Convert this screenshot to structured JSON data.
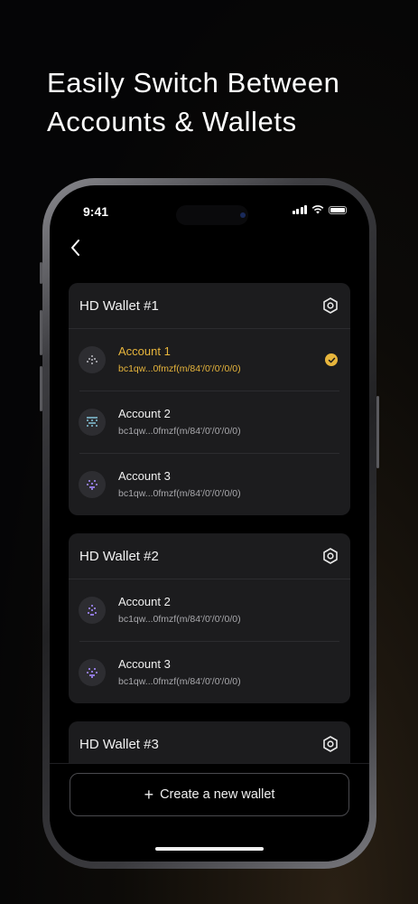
{
  "headline": "Easily Switch Between\nAccounts & Wallets",
  "status_bar": {
    "time": "9:41"
  },
  "colors": {
    "accent": "#e7b53c",
    "card_bg": "#1c1c1e",
    "background": "#000000"
  },
  "wallets": [
    {
      "name": "HD Wallet #1",
      "accounts": [
        {
          "name": "Account 1",
          "address": "bc1qw...0fmzf(m/84'/0'/0'/0/0)",
          "selected": true
        },
        {
          "name": "Account 2",
          "address": "bc1qw...0fmzf(m/84'/0'/0'/0/0)",
          "selected": false
        },
        {
          "name": "Account 3",
          "address": "bc1qw...0fmzf(m/84'/0'/0'/0/0)",
          "selected": false
        }
      ]
    },
    {
      "name": "HD Wallet #2",
      "accounts": [
        {
          "name": "Account 2",
          "address": "bc1qw...0fmzf(m/84'/0'/0'/0/0)",
          "selected": false
        },
        {
          "name": "Account 3",
          "address": "bc1qw...0fmzf(m/84'/0'/0'/0/0)",
          "selected": false
        }
      ]
    },
    {
      "name": "HD Wallet #3",
      "accounts": []
    }
  ],
  "create_button": {
    "icon": "plus-icon",
    "label": "Create a new wallet"
  }
}
